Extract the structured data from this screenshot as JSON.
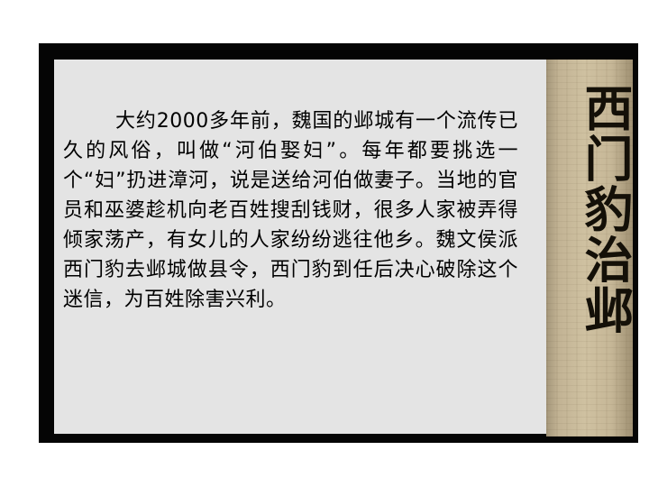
{
  "passage": {
    "text": "大约2000多年前，魏国的邺城有一个流传已久的风俗，叫做“河伯娶妇”。每年都要挑选一个“妇”扔进漳河，说是送给河伯做妻子。当地的官员和巫婆趁机向老百姓搜刮钱财，很多人家被弄得倾家荡产，有女儿的人家纷纷逃往他乡。魏文侯派西门豹去邺城做县令，西门豹到任后决心破除这个迷信，为百姓除害兴利。"
  },
  "scroll": {
    "title": "西门豹治邺"
  }
}
